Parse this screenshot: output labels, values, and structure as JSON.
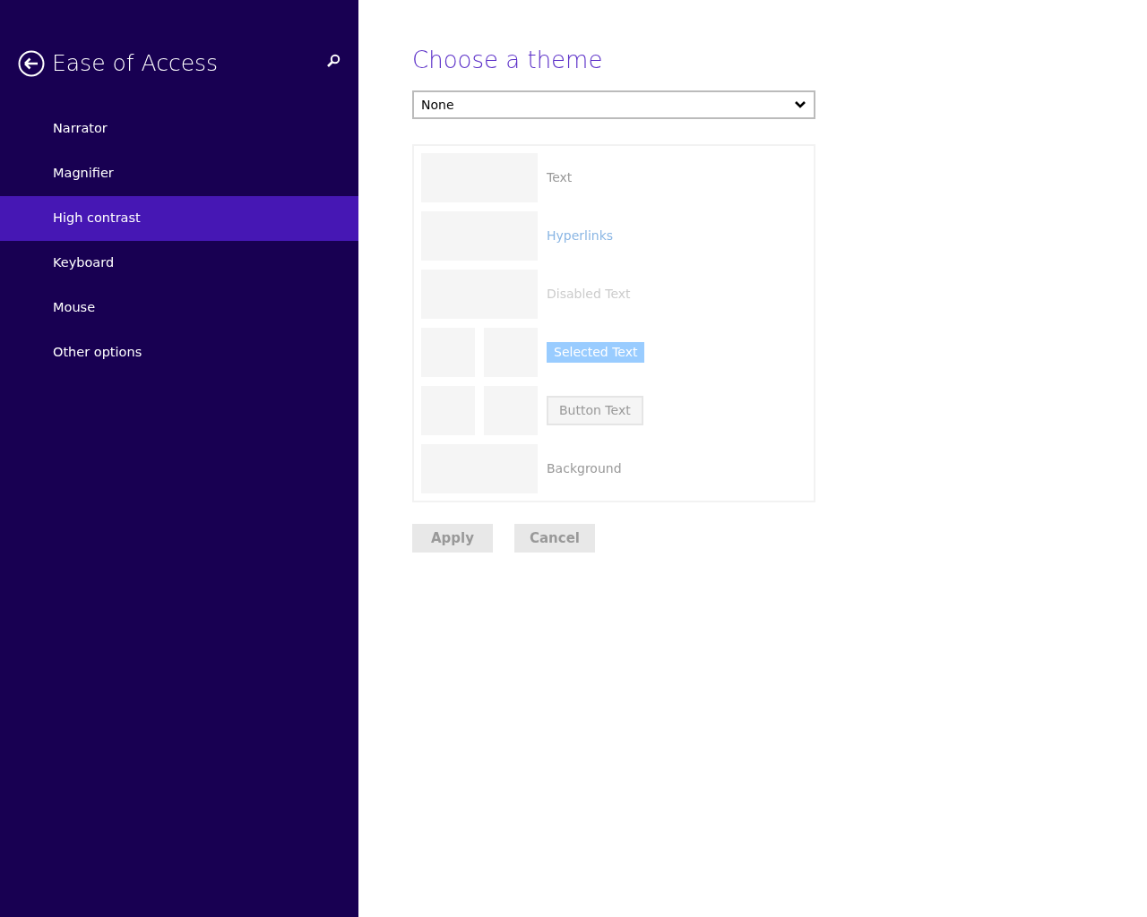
{
  "sidebar": {
    "title": "Ease of Access",
    "items": [
      {
        "label": "Narrator",
        "selected": false
      },
      {
        "label": "Magnifier",
        "selected": false
      },
      {
        "label": "High contrast",
        "selected": true
      },
      {
        "label": "Keyboard",
        "selected": false
      },
      {
        "label": "Mouse",
        "selected": false
      },
      {
        "label": "Other options",
        "selected": false
      }
    ]
  },
  "main": {
    "heading": "Choose a theme",
    "theme_select": {
      "value": "None"
    },
    "preview": [
      {
        "kind": "text",
        "label": "Text"
      },
      {
        "kind": "link",
        "label": "Hyperlinks"
      },
      {
        "kind": "disabled",
        "label": "Disabled Text"
      },
      {
        "kind": "selected",
        "label": "Selected Text"
      },
      {
        "kind": "button",
        "label": "Button Text"
      },
      {
        "kind": "background",
        "label": "Background"
      }
    ],
    "buttons": [
      {
        "label": "Apply",
        "disabled": true
      },
      {
        "label": "Cancel",
        "disabled": true
      }
    ]
  }
}
